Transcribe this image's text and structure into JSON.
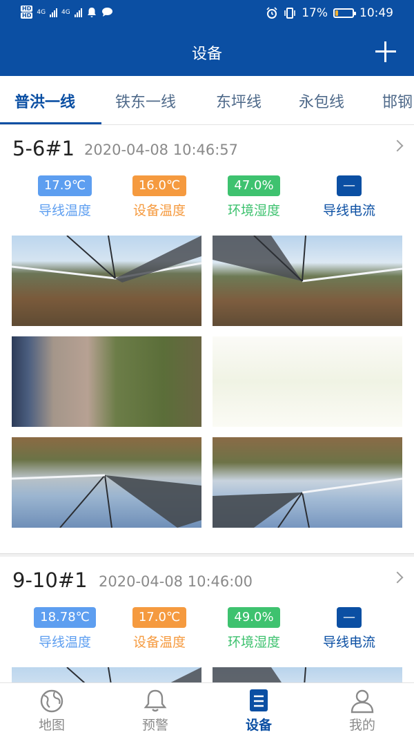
{
  "status_bar": {
    "hd1": "HD",
    "hd2": "HD",
    "net1": "4G",
    "net2": "4G",
    "battery_percent": "17%",
    "battery_level": 0.17,
    "time": "10:49",
    "icons": [
      "hd-icon",
      "signal-icon",
      "bell-icon",
      "chat-icon",
      "alarm-icon",
      "vibrate-icon",
      "battery-icon"
    ]
  },
  "header": {
    "title": "设备"
  },
  "tabs": [
    {
      "label": "普洪一线",
      "active": true
    },
    {
      "label": "铁东一线"
    },
    {
      "label": "东坪线"
    },
    {
      "label": "永包线"
    },
    {
      "label": "邯钢"
    }
  ],
  "devices": [
    {
      "name": "5-6#1",
      "time": "2020-04-08 10:46:57",
      "metrics": [
        {
          "value": "17.9℃",
          "label": "导线温度",
          "color": "#5d9ef0"
        },
        {
          "value": "16.0℃",
          "label": "设备温度",
          "color": "#f59a3f"
        },
        {
          "value": "47.0%",
          "label": "环境湿度",
          "color": "#3ec26f"
        },
        {
          "value": "—",
          "label": "导线电流",
          "color": "#0b4fa3"
        }
      ]
    },
    {
      "name": "9-10#1",
      "time": "2020-04-08 10:46:00",
      "metrics": [
        {
          "value": "18.78℃",
          "label": "导线温度",
          "color": "#5d9ef0"
        },
        {
          "value": "17.0℃",
          "label": "设备温度",
          "color": "#f59a3f"
        },
        {
          "value": "49.0%",
          "label": "环境湿度",
          "color": "#3ec26f"
        },
        {
          "value": "—",
          "label": "导线电流",
          "color": "#0b4fa3"
        }
      ]
    }
  ],
  "nav": [
    {
      "label": "地图",
      "icon": "globe-icon"
    },
    {
      "label": "预警",
      "icon": "bell-icon"
    },
    {
      "label": "设备",
      "icon": "device-list-icon",
      "active": true
    },
    {
      "label": "我的",
      "icon": "user-icon"
    }
  ]
}
